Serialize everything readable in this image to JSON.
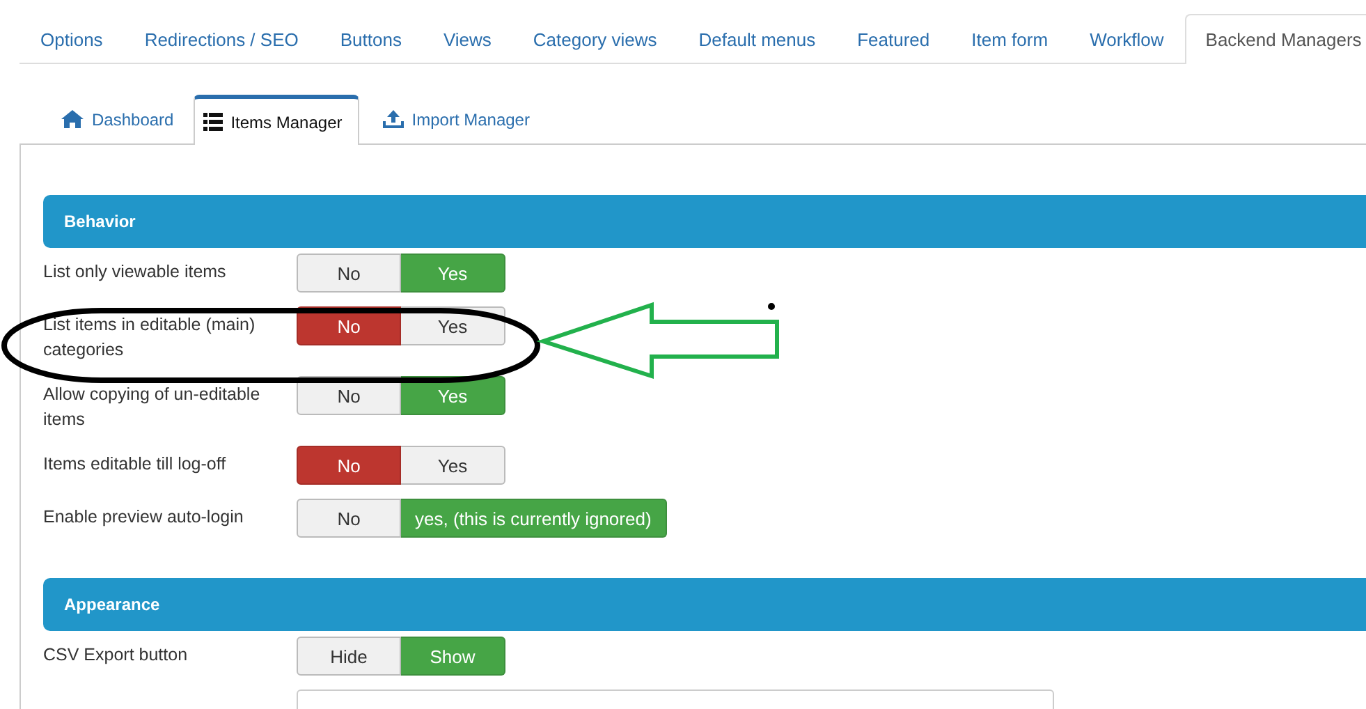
{
  "tabs": [
    {
      "label": "Options",
      "selected": false
    },
    {
      "label": "Redirections / SEO",
      "selected": false
    },
    {
      "label": "Buttons",
      "selected": false
    },
    {
      "label": "Views",
      "selected": false
    },
    {
      "label": "Category views",
      "selected": false
    },
    {
      "label": "Default menus",
      "selected": false
    },
    {
      "label": "Featured",
      "selected": false
    },
    {
      "label": "Item form",
      "selected": false
    },
    {
      "label": "Workflow",
      "selected": false
    },
    {
      "label": "Backend Managers",
      "selected": true
    }
  ],
  "subtabs": [
    {
      "label": "Dashboard",
      "selected": false
    },
    {
      "label": "Items Manager",
      "selected": true
    },
    {
      "label": "Import Manager",
      "selected": false
    }
  ],
  "sections": [
    {
      "title": "Behavior",
      "settings": [
        {
          "kind": "toggle",
          "label": "List only viewable items",
          "options": [
            {
              "label": "No",
              "kind": "no",
              "selected": false
            },
            {
              "label": "Yes",
              "kind": "yes",
              "selected": true
            }
          ]
        },
        {
          "kind": "toggle",
          "label": "List items in editable (main) categories",
          "options": [
            {
              "label": "No",
              "kind": "no",
              "selected": true
            },
            {
              "label": "Yes",
              "kind": "yes",
              "selected": false
            }
          ]
        },
        {
          "kind": "toggle",
          "label": "Allow copying of un-editable items",
          "options": [
            {
              "label": "No",
              "kind": "no",
              "selected": false
            },
            {
              "label": "Yes",
              "kind": "yes",
              "selected": true
            }
          ]
        },
        {
          "kind": "toggle",
          "label": "Items editable till log-off",
          "options": [
            {
              "label": "No",
              "kind": "no",
              "selected": true
            },
            {
              "label": "Yes",
              "kind": "yes",
              "selected": false
            }
          ]
        },
        {
          "kind": "toggle",
          "label": "Enable preview auto-login",
          "options": [
            {
              "label": "No",
              "kind": "no",
              "selected": false
            },
            {
              "label": "yes, (this is currently ignored)",
              "kind": "yes",
              "selected": true
            }
          ]
        }
      ]
    },
    {
      "title": "Appearance",
      "settings": [
        {
          "kind": "toggle",
          "label": "CSV Export button",
          "options": [
            {
              "label": "Hide",
              "kind": "no",
              "selected": false
            },
            {
              "label": "Show",
              "kind": "yes",
              "selected": true
            }
          ]
        },
        {
          "kind": "field"
        }
      ]
    }
  ]
}
